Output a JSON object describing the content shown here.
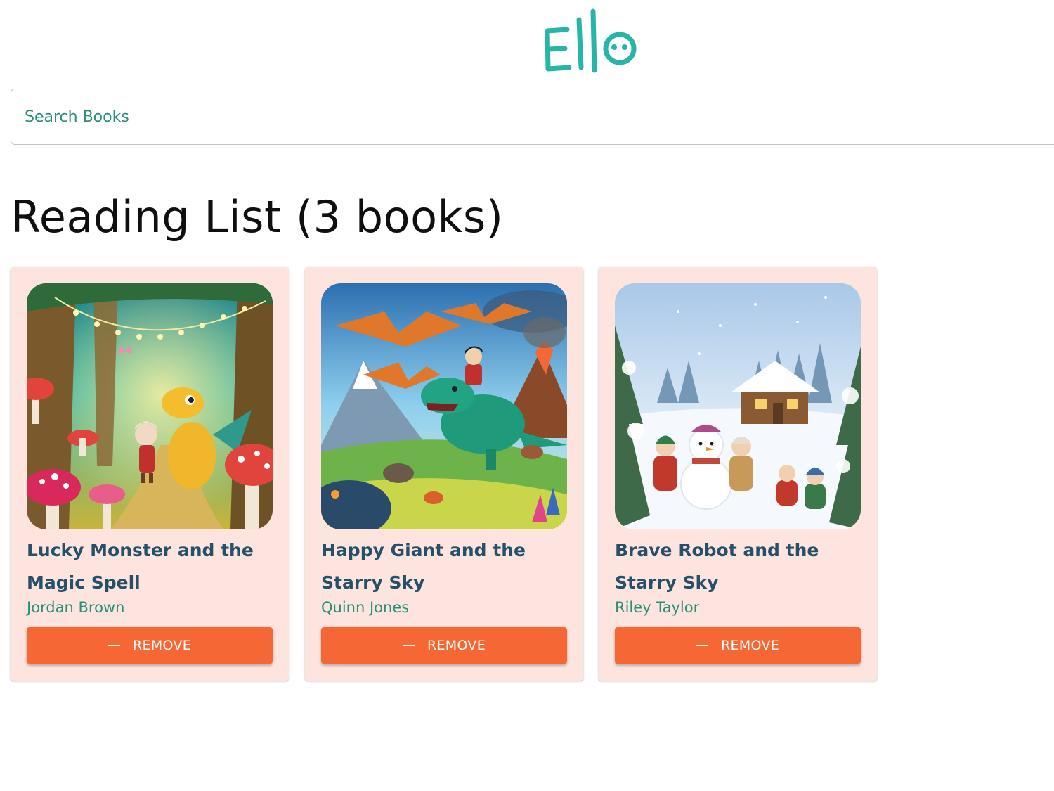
{
  "app": {
    "logo_text": "Ello"
  },
  "search": {
    "placeholder": "Search Books"
  },
  "reading_list": {
    "heading": "Reading List (3 books)",
    "books": [
      {
        "title": "Lucky Monster and the Magic Spell",
        "author": "Jordan Brown",
        "remove_label": "REMOVE",
        "cover_icon": "fantasy-forest-cover"
      },
      {
        "title": "Happy Giant and the Starry Sky",
        "author": "Quinn Jones",
        "remove_label": "REMOVE",
        "cover_icon": "dinosaur-adventure-cover"
      },
      {
        "title": "Brave Robot and the Starry Sky",
        "author": "Riley Taylor",
        "remove_label": "REMOVE",
        "cover_icon": "winter-snowman-cover"
      }
    ]
  },
  "colors": {
    "brand_teal": "#27b5a8",
    "card_background": "#fde4de",
    "title_text": "#25506a",
    "author_text": "#2a8f79",
    "remove_button": "#f56734"
  }
}
